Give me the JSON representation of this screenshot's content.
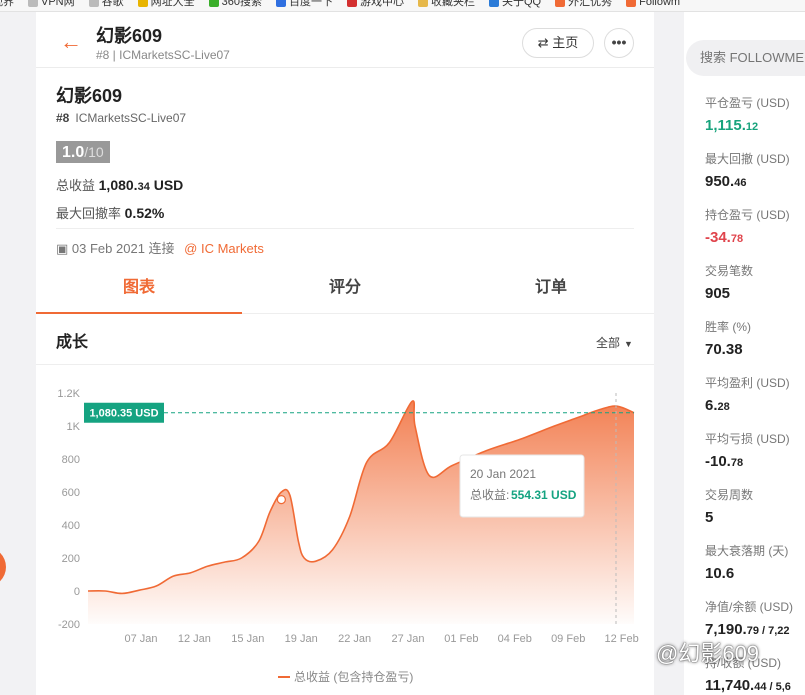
{
  "bookmarks": [
    {
      "label": "视界",
      "color": "#e46a2b"
    },
    {
      "label": "VPN网",
      "color": "#bbbbbb"
    },
    {
      "label": "谷歌",
      "color": "#bbbbbb"
    },
    {
      "label": "网址大全",
      "color": "#e8b400"
    },
    {
      "label": "360搜索",
      "color": "#3aae2a"
    },
    {
      "label": "百度一下",
      "color": "#2f6fe0"
    },
    {
      "label": "游戏中心",
      "color": "#d32f2f"
    },
    {
      "label": "收藏夹栏",
      "color": "#e6b84a"
    },
    {
      "label": "关于QQ",
      "color": "#2b7bd8"
    },
    {
      "label": "外汇优秀",
      "color": "#f06a35"
    },
    {
      "label": "Followm",
      "color": "#f06a35"
    }
  ],
  "header": {
    "back_icon": "arrow-left-icon",
    "name": "幻影609",
    "sub": "#8 | ICMarketsSC-Live07",
    "home_label": "⇄ 主页",
    "more_label": "•••"
  },
  "profile": {
    "name": "幻影609",
    "rank": "#8",
    "server": "ICMarketsSC-Live07",
    "score": "1.0",
    "score_of": "/10",
    "gain_label": "总收益",
    "gain_main": "1,080.",
    "gain_dec": "34",
    "gain_unit": "USD",
    "dd_label": "最大回撤率",
    "dd_value": "0.52%",
    "since": "03 Feb 2021 连接",
    "broker": "@ IC Markets"
  },
  "tabs": [
    {
      "label": "图表",
      "active": true
    },
    {
      "label": "评分",
      "active": false
    },
    {
      "label": "订单",
      "active": false
    }
  ],
  "section": {
    "title": "成长",
    "range": "全部"
  },
  "chart_data": {
    "type": "area",
    "yticks": [
      "1.2K",
      "1K",
      "800",
      "600",
      "400",
      "200",
      "0",
      "-200"
    ],
    "ylim": [
      -200,
      1200
    ],
    "xticks": [
      "07 Jan",
      "12 Jan",
      "15 Jan",
      "19 Jan",
      "22 Jan",
      "27 Jan",
      "01 Feb",
      "04 Feb",
      "09 Feb",
      "12 Feb"
    ],
    "series": [
      {
        "name": "总收益 (包含持仓盈亏)",
        "color": "#f06a35",
        "points": [
          [
            0,
            0
          ],
          [
            0.3,
            0
          ],
          [
            0.6,
            -15
          ],
          [
            0.9,
            5
          ],
          [
            1.2,
            30
          ],
          [
            1.5,
            90
          ],
          [
            1.8,
            110
          ],
          [
            2.1,
            150
          ],
          [
            2.4,
            175
          ],
          [
            2.7,
            200
          ],
          [
            3.0,
            300
          ],
          [
            3.2,
            480
          ],
          [
            3.4,
            600
          ],
          [
            3.55,
            580
          ],
          [
            3.7,
            300
          ],
          [
            3.8,
            200
          ],
          [
            4.0,
            180
          ],
          [
            4.3,
            250
          ],
          [
            4.6,
            450
          ],
          [
            4.9,
            780
          ],
          [
            5.3,
            900
          ],
          [
            5.7,
            1150
          ],
          [
            5.75,
            1000
          ],
          [
            6.0,
            700
          ],
          [
            6.4,
            760
          ],
          [
            7.0,
            850
          ],
          [
            7.6,
            920
          ],
          [
            8.2,
            1000
          ],
          [
            8.6,
            1050
          ],
          [
            9.0,
            1100
          ],
          [
            9.3,
            1120
          ],
          [
            9.6,
            1080
          ]
        ]
      }
    ],
    "current_label": "1,080.35 USD",
    "current_value": 1080.35,
    "hover_point": [
      3.4,
      554
    ],
    "tooltip": {
      "date": "20 Jan 2021",
      "label": "总收益:",
      "value": "554.31 USD"
    },
    "legend": "总收益 (包含持仓盈亏)"
  },
  "search": {
    "placeholder": "搜索 FOLLOWME"
  },
  "stats": [
    {
      "label": "平仓盈亏 (USD)",
      "main": "1,115.",
      "dec": "12",
      "tone": "pos"
    },
    {
      "label": "最大回撤 (USD)",
      "main": "950.",
      "dec": "46",
      "tone": ""
    },
    {
      "label": "持仓盈亏 (USD)",
      "main": "-34.",
      "dec": "78",
      "tone": "neg"
    },
    {
      "label": "交易笔数",
      "main": "905",
      "dec": "",
      "tone": ""
    },
    {
      "label": "胜率 (%)",
      "main": "70.38",
      "dec": "",
      "tone": ""
    },
    {
      "label": "平均盈利 (USD)",
      "main": "6.",
      "dec": "28",
      "tone": ""
    },
    {
      "label": "平均亏损 (USD)",
      "main": "-10.",
      "dec": "78",
      "tone": ""
    },
    {
      "label": "交易周数",
      "main": "5",
      "dec": "",
      "tone": ""
    },
    {
      "label": "最大衰落期 (天)",
      "main": "10.6",
      "dec": "",
      "tone": ""
    },
    {
      "label": "净值/余额 (USD)",
      "main": "7,190.",
      "dec": "79 / 7,22",
      "tone": ""
    },
    {
      "label": "持/收额 (USD)",
      "main": "11,740.",
      "dec": "44 / 5,6",
      "tone": ""
    }
  ],
  "watermark": "@幻影609"
}
